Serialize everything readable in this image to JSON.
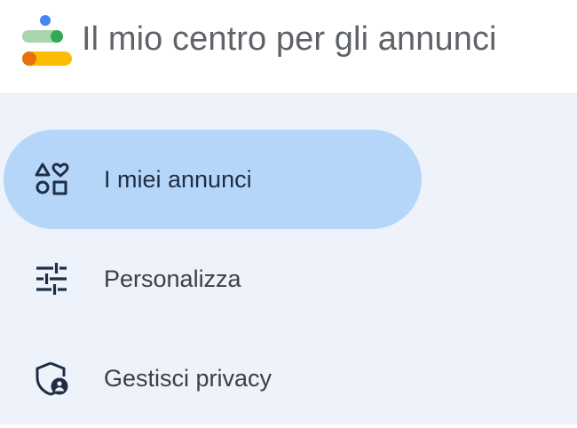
{
  "header": {
    "title": "Il mio centro per gli annunci",
    "logo_icon": "ads-center-logo-icon"
  },
  "sidebar": {
    "items": [
      {
        "label": "I miei annunci",
        "icon": "shapes-icon",
        "active": true
      },
      {
        "label": "Personalizza",
        "icon": "tune-sliders-icon",
        "active": false
      },
      {
        "label": "Gestisci privacy",
        "icon": "shield-person-icon",
        "active": false
      }
    ]
  },
  "colors": {
    "active_background": "#b6d6f9",
    "sidebar_background": "#edf2fb",
    "icon_color": "#1f2d45",
    "title_color": "#5f6368",
    "logo_blue": "#4285f4",
    "logo_green": "#34a853",
    "logo_yellow": "#fbbc04",
    "logo_orange": "#e8710a"
  }
}
